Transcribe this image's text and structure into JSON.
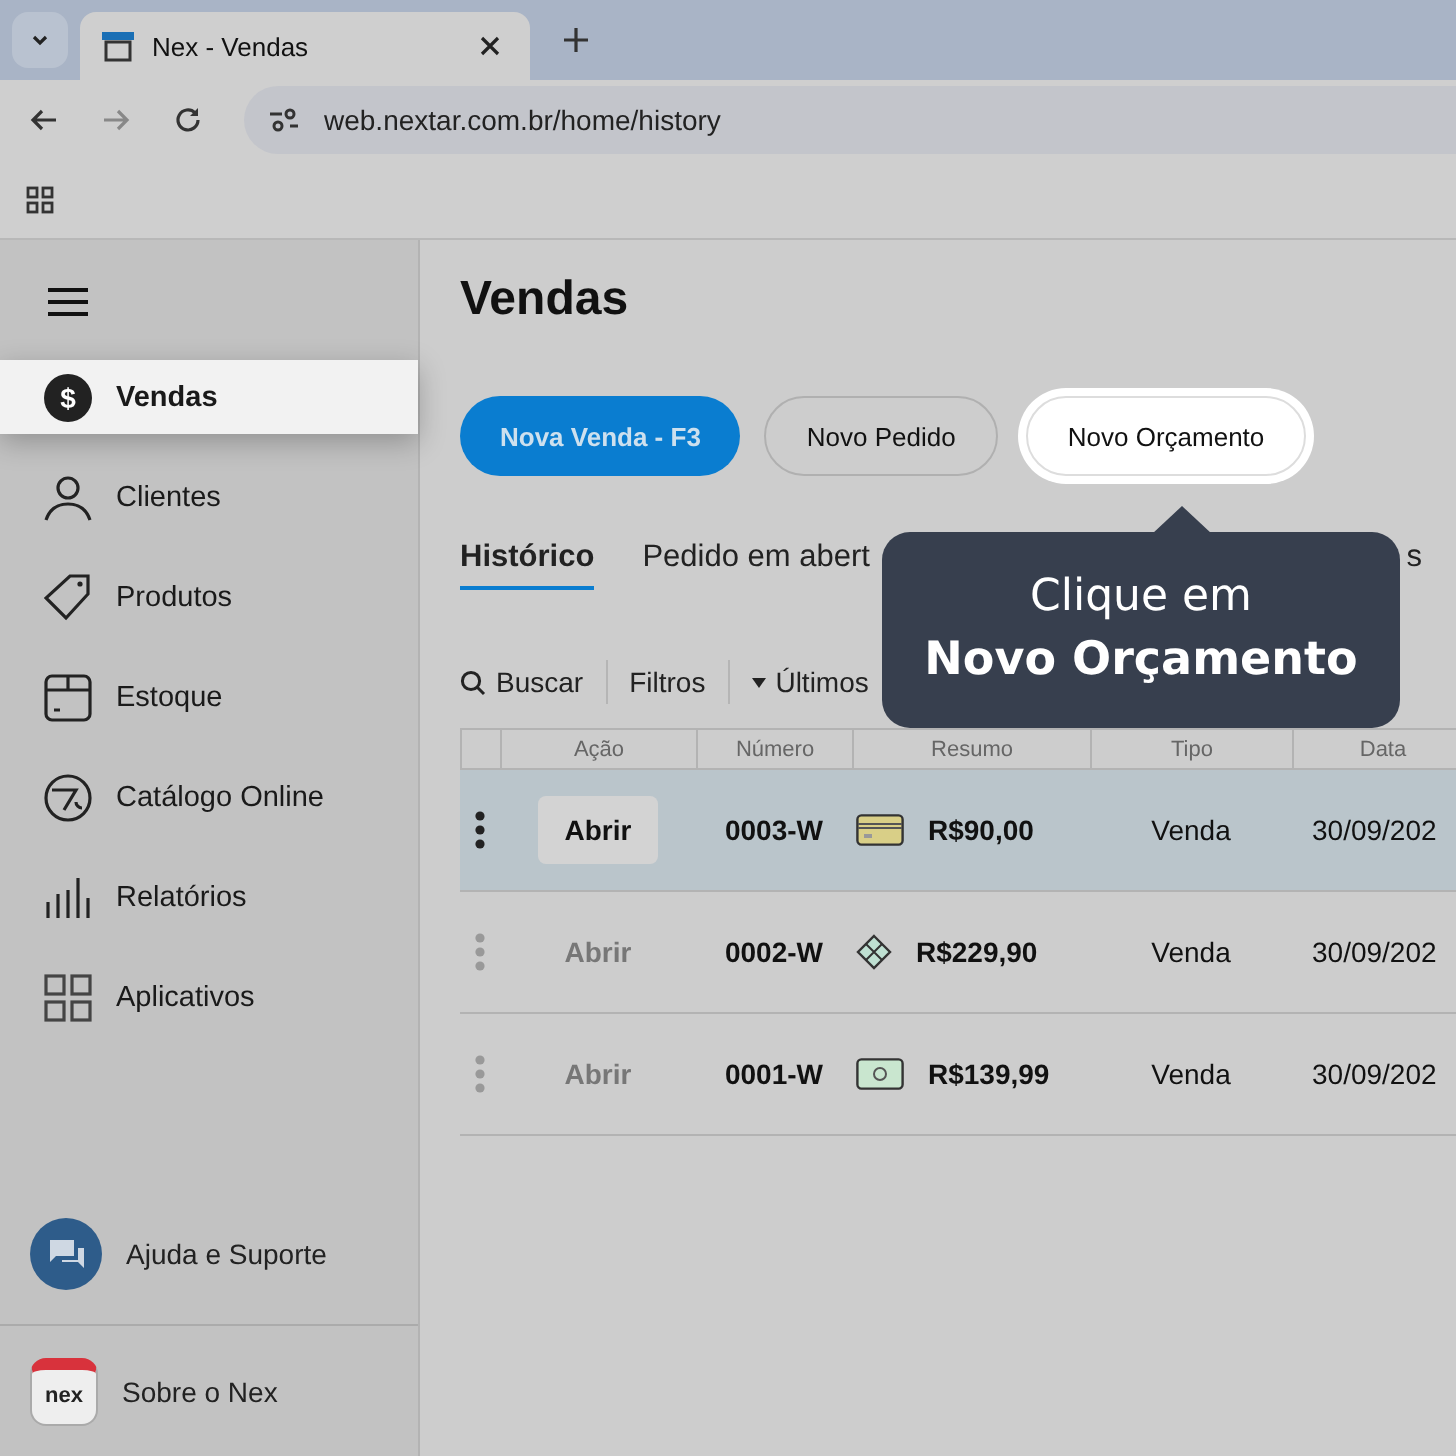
{
  "browser": {
    "tab_title": "Nex - Vendas",
    "url": "web.nextar.com.br/home/history"
  },
  "sidebar": {
    "items": [
      {
        "label": "Vendas",
        "selected": true,
        "icon_glyph": "$"
      },
      {
        "label": "Clientes",
        "selected": false
      },
      {
        "label": "Produtos",
        "selected": false
      },
      {
        "label": "Estoque",
        "selected": false
      },
      {
        "label": "Catálogo Online",
        "selected": false
      },
      {
        "label": "Relatórios",
        "selected": false
      },
      {
        "label": "Aplicativos",
        "selected": false
      }
    ],
    "help": "Ajuda e Suporte",
    "about": "Sobre o Nex",
    "logo_text": "nex"
  },
  "page": {
    "title": "Vendas",
    "actions": [
      {
        "label": "Nova Venda - F3",
        "kind": "primary"
      },
      {
        "label": "Novo Pedido",
        "kind": "secondary"
      },
      {
        "label": "Novo Orçamento",
        "kind": "highlighted"
      }
    ],
    "tabs": [
      {
        "label": "Histórico",
        "selected": true
      },
      {
        "label": "Pedido em abert",
        "selected": false
      },
      {
        "label": "s",
        "selected": false
      }
    ],
    "toolbar": {
      "search": "Buscar",
      "filters": "Filtros",
      "period": "Últimos"
    },
    "table": {
      "columns": [
        "Ação",
        "Número",
        "Resumo",
        "Tipo",
        "Data"
      ],
      "rows": [
        {
          "action": "Abrir",
          "number": "0003-W",
          "total": "R$90,00",
          "type": "Venda",
          "date": "30/09/202",
          "selected": true
        },
        {
          "action": "Abrir",
          "number": "0002-W",
          "total": "R$229,90",
          "type": "Venda",
          "date": "30/09/202",
          "selected": false
        },
        {
          "action": "Abrir",
          "number": "0001-W",
          "total": "R$139,99",
          "type": "Venda",
          "date": "30/09/202",
          "selected": false
        }
      ]
    }
  },
  "tooltip": {
    "line_1": "Clique em",
    "line_2": "Novo Orçamento"
  }
}
